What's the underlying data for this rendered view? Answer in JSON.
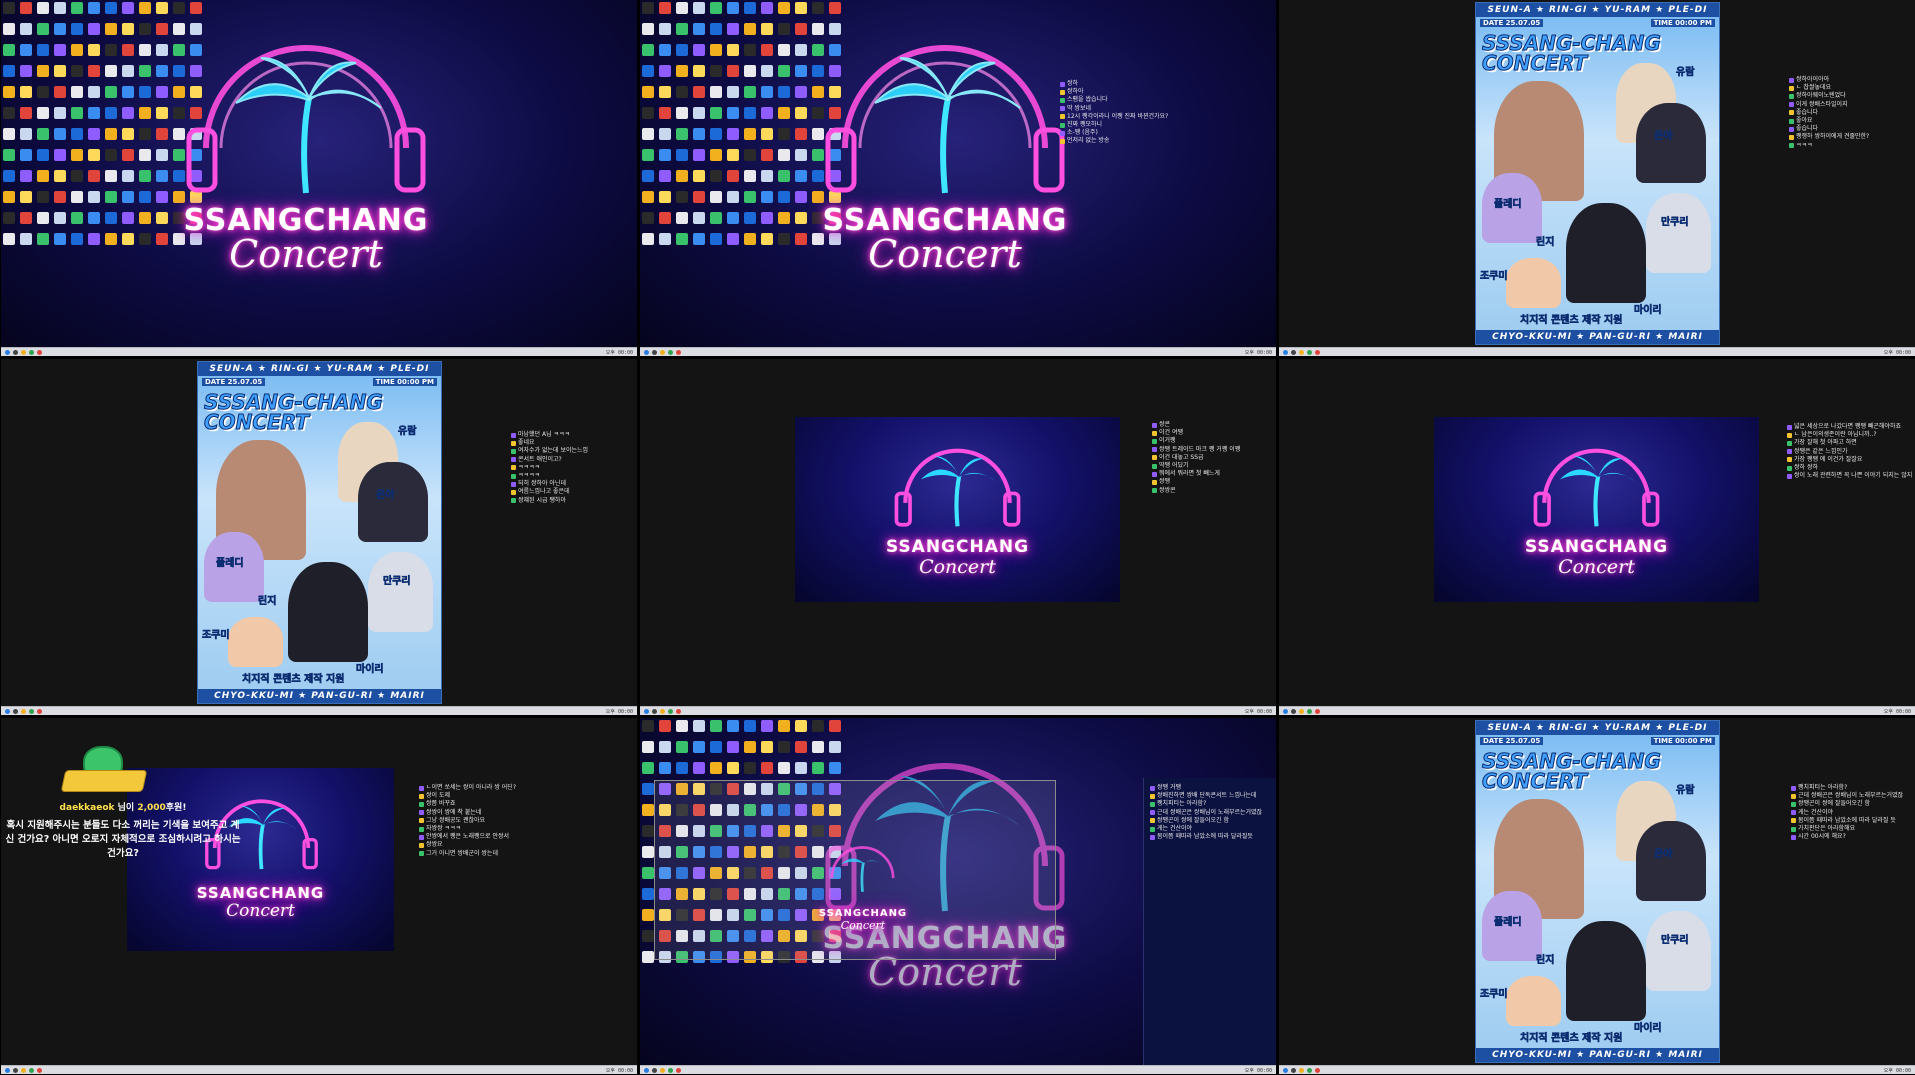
{
  "logo": {
    "title": "SSANGCHANG",
    "subtitle": "Concert"
  },
  "poster": {
    "top_banner": "SEUN-A ★ RIN-GI ★ YU-RAM ★ PLE-DI",
    "date": "DATE 25.07.05",
    "time": "TIME 00:00 PM",
    "title_line1": "SSSANG-CHANG",
    "title_line2": "CONCERT",
    "names": [
      "유람",
      "은아",
      "플레디",
      "린지",
      "만쿠리",
      "조쿠미",
      "마이리"
    ],
    "credit": "치지직 콘텐츠 제작 지원",
    "bottom_banner": "CHYO-KKU-MI ★ PAN-GU-RI ★ MAIRI"
  },
  "taskbar_time": "오후 00:00",
  "donation": {
    "user": "daekkaeok",
    "suffix": " 님이 ",
    "amount": "2,000",
    "amount_suffix": "후원!",
    "message": "혹시 지원해주시는 분들도 다소 꺼리는 기색을 보여주고 계신 건가요? 아니면 오로지 자체적으로 조심하시려고 하시는 건가요?"
  },
  "chats": {
    "p2": [
      "쌍하",
      "쌍하아",
      "스팸을 쌉습니다",
      "딱 쌍보네",
      "12시 쨍각이라니 이쨍 진짜 바뀐건가요?",
      "진짜 쨍모하니",
      "소-쨍 (음주)",
      "언저리 없는 방송"
    ],
    "p3": [
      "쌍하아이아아",
      "ㄴ 찹쌀놓데요",
      "쌍하아웨이노텐었다",
      "이게 쌍배스타일이지",
      "좋습니다",
      "좋아요",
      "좋습니다",
      "쨍쟁하 쌍하이에게 견줄만한?",
      "ㅋㅋㅋ"
    ],
    "p4": [
      "마남했던 A님 ㅋㅋㅋ",
      "좋네요",
      "여자수가 없는데 보이는느낌",
      "콘서트 애인이고?",
      "ㅋㅋㅋㅋ",
      "ㅋㅋㅋㅋ",
      "되히 쌍하아 아닌데",
      "여름느낌나고 좋은데",
      "쌍쟤된 시급 쨍하아"
    ],
    "p5": [
      "쌍콘",
      "이건 여쨍",
      "이거쨍",
      "쌍쨍 트레이드 마크 쨍 거쨍 이쨍",
      "이건 대놓고 SS급",
      "딱쨍 어딨기",
      "뭐에서 뭐라면 첫 빼느게",
      "쌍쨍",
      "쌍쌍콘"
    ],
    "p6": [
      "넓은 세상으로 나갔다면 쨍쨍 빼곤해야하죠",
      "ㄴ 남은이의생존이란 아닙니까..?",
      "가장 잘해 첫 아파고 하면",
      "쌍쨍은 같은 느낌인가",
      "가장 쨍쨍 에 이건가 잘잘요",
      "쌍하 쌍하",
      "쌍이 노래 관련하면 꼭 나쁜 이야기 되지는 않지"
    ],
    "p7": [
      "ㄴ이면 쏘세는 쌍이 아니라 쌍 어딘?",
      "쌍이 도제",
      "쌍쯤 바꾸죠",
      "쌍쌍이 쌍에 착 붙는네",
      "그냥 쌍배공도 괜찮아요",
      "자쌍쌍 ㅋㅋㅋ",
      "안쌍에서 쨍은 노래쨍으로 안쌍서",
      "쌍쌍요",
      "그거 아니면 쌍배군이 쌍는데"
    ],
    "p8": [
      "쌍쨍 거쨍",
      "쌍배진하면 쌍배 단독콘서트 느낌나는데",
      "쨍치피티는 아라함?",
      "근데 쌍배곤은 쌍배님이 노래부르는거였잖",
      "쌍쨍곤이 쌍에 잘들어오긴 함",
      "게는 건산이야",
      "몸이쯤 때따라 남았소에 따라 달라질듯"
    ],
    "p9": [
      "쨍치피티는 아라함?",
      "근데 쌍배곤은 쌍배님이 노래부르는거였잖",
      "쌍쨍곤이 쌍에 잘들어오긴 함",
      "게는 건산이야",
      "몸이쯤 때따라 남았소에 따라 달라질 듯",
      "가치판단은 아라함해요",
      "시간 00시에 해요?"
    ]
  }
}
